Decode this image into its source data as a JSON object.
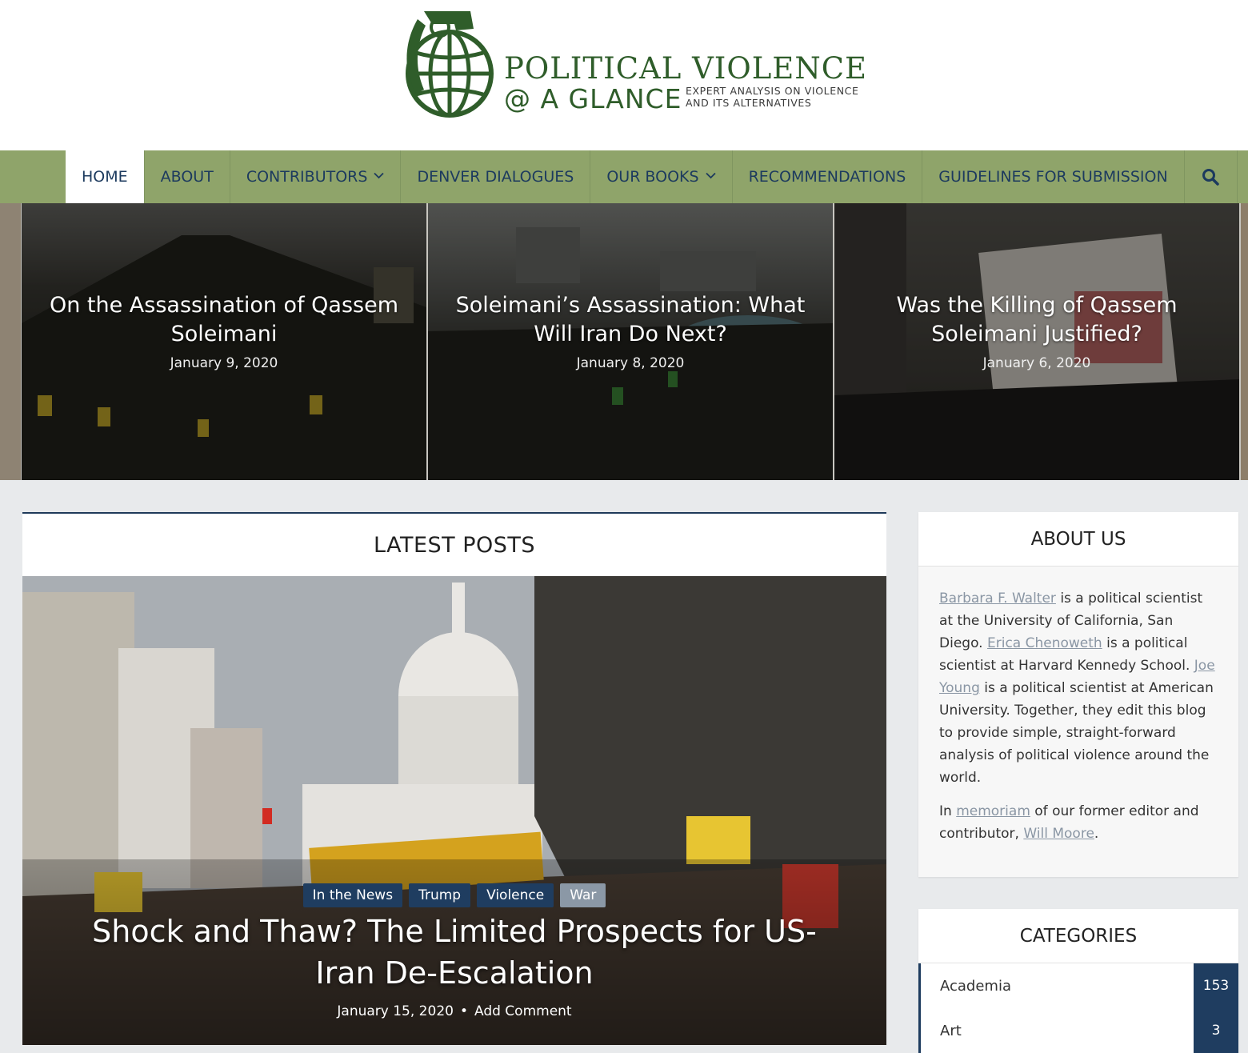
{
  "site": {
    "title": "POLITICAL VIOLENCE",
    "subtitle": "@ A GLANCE",
    "tagline": "EXPERT ANALYSIS ON VIOLENCE AND ITS ALTERNATIVES"
  },
  "nav": {
    "items": [
      {
        "label": "HOME"
      },
      {
        "label": "ABOUT"
      },
      {
        "label": "CONTRIBUTORS"
      },
      {
        "label": "DENVER DIALOGUES"
      },
      {
        "label": "OUR BOOKS"
      },
      {
        "label": "RECOMMENDATIONS"
      },
      {
        "label": "GUIDELINES FOR SUBMISSION"
      }
    ]
  },
  "slides": [
    {
      "title": "On the Assassination of Qassem Soleimani",
      "date": "January 9, 2020"
    },
    {
      "title": "Soleimani’s Assassination: What Will Iran Do Next?",
      "date": "January 8, 2020"
    },
    {
      "title": "Was the Killing of Qassem Soleimani Justified?",
      "date": "January 6, 2020"
    }
  ],
  "latest": {
    "heading": "LATEST POSTS",
    "tags": [
      "In the News",
      "Trump",
      "Violence",
      "War"
    ],
    "title": "Shock and Thaw? The Limited Prospects for US-Iran De-Escalation",
    "date": "January 15, 2020",
    "separator": "•",
    "comment_link": "Add Comment"
  },
  "about": {
    "heading": "ABOUT US",
    "name1": "Barbara F. Walter",
    "text1": " is a political scientist at the University of California, San Diego. ",
    "name2": "Erica Chenoweth",
    "text2": " is a political scientist at Harvard Kennedy School. ",
    "name3": "Joe Young",
    "text3": " is a political scientist at American University. Together, they edit this blog to provide simple, straight-forward analysis of political violence around the world.",
    "p2_pre": "In ",
    "p2_link1": "memoriam",
    "p2_mid": " of our former editor and contributor, ",
    "p2_link2": "Will Moore",
    "p2_end": "."
  },
  "categories": {
    "heading": "CATEGORIES",
    "items": [
      {
        "name": "Academia",
        "count": "153"
      },
      {
        "name": "Art",
        "count": "3"
      }
    ]
  },
  "colors": {
    "brand_green": "#2f5d2a",
    "nav_green": "#8fa46a",
    "nav_text": "#1c3a5e",
    "accent_navy": "#1f3d60"
  }
}
